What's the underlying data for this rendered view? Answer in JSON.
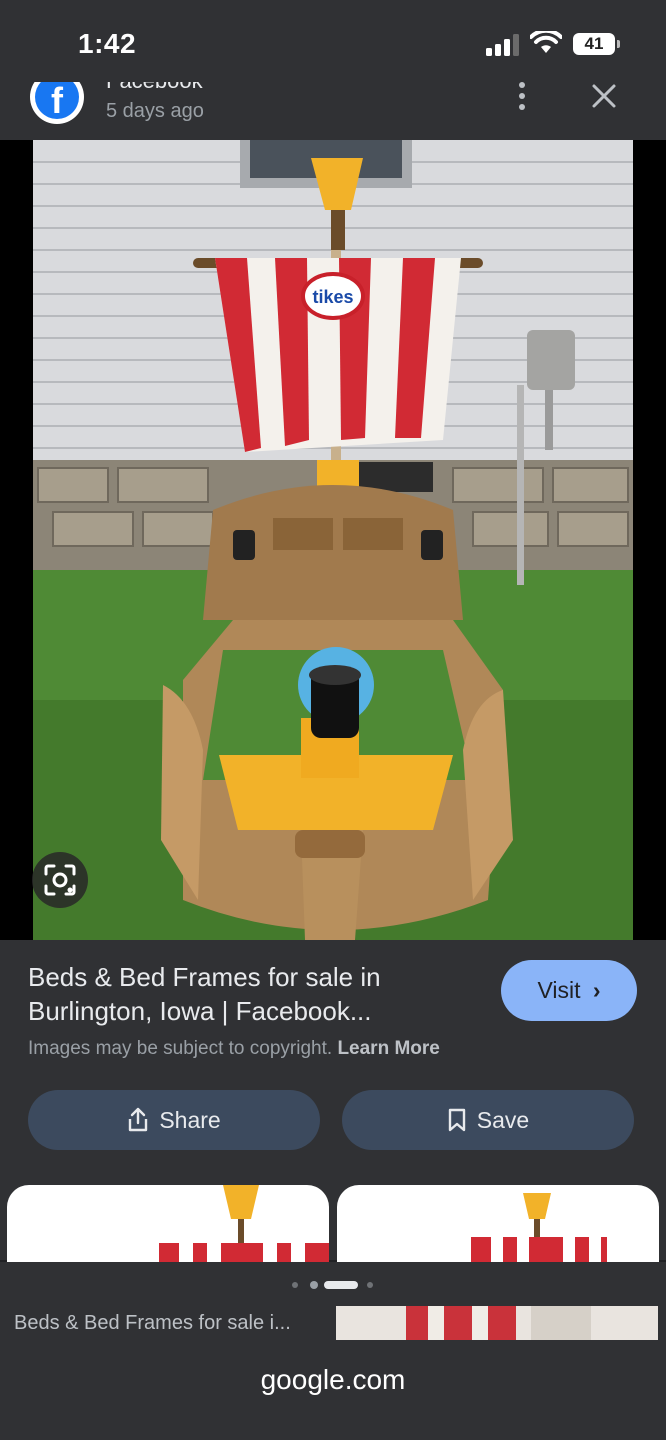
{
  "status_bar": {
    "time": "1:42",
    "battery": "41"
  },
  "source": {
    "name": "Facebook",
    "time_ago": "5 days ago"
  },
  "result": {
    "title": "Beds & Bed Frames for sale in\nBurlington, Iowa | Facebook...",
    "visit_label": "Visit",
    "copyright_text": "Images may be subject to copyright.",
    "learn_more": "Learn More",
    "share_label": "Share",
    "save_label": "Save"
  },
  "photo": {
    "flag_logo": "tikes"
  },
  "related": {
    "caption": "Beds & Bed Frames for sale i..."
  },
  "browser": {
    "url": "google.com"
  },
  "colors": {
    "accent": "#8ab4f8",
    "panel": "#303134",
    "button": "#3c4a5e"
  }
}
